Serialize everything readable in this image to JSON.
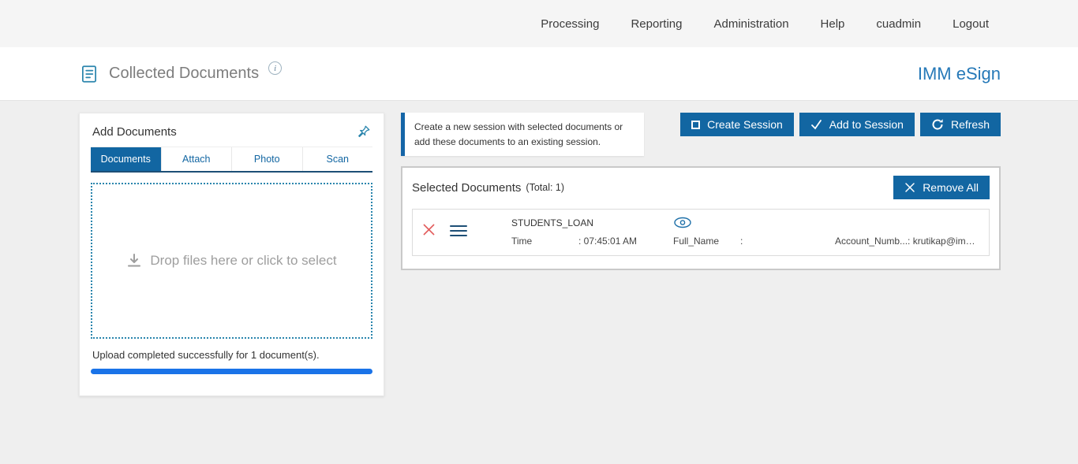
{
  "colors": {
    "primary_button": "#1266a2",
    "brand_text": "#2679b8",
    "progress_bar": "#1a73e8",
    "dropzone_border": "#2a85ad",
    "info_box_border": "#1565a7",
    "delete_icon": "#e25b5b"
  },
  "topnav": {
    "items": [
      "Processing",
      "Reporting",
      "Administration",
      "Help",
      "cuadmin",
      "Logout"
    ]
  },
  "header": {
    "title": "Collected Documents",
    "info_icon": "i",
    "brand": "IMM eSign"
  },
  "add_documents": {
    "title": "Add Documents",
    "tabs": [
      {
        "label": "Documents"
      },
      {
        "label": "Attach"
      },
      {
        "label": "Photo"
      },
      {
        "label": "Scan"
      }
    ],
    "dropzone_text": "Drop files here or click to select",
    "upload_status": "Upload completed successfully for 1 document(s)."
  },
  "session": {
    "message": "Create a new session with selected documents or add these documents to an existing session."
  },
  "actions": {
    "create_session": "Create Session",
    "add_to_session": "Add to Session",
    "refresh": "Refresh"
  },
  "selected_documents": {
    "title": "Selected Documents",
    "total": "(Total: 1)",
    "remove_all": "Remove All",
    "rows": [
      {
        "name": "STUDENTS_LOAN",
        "time_label": "Time",
        "time_value": ": 07:45:01 AM",
        "full_name_label": "Full_Name",
        "full_name_value": ":",
        "account_label": "Account_Numb...",
        "account_value": ": krutikap@imm..."
      }
    ]
  }
}
